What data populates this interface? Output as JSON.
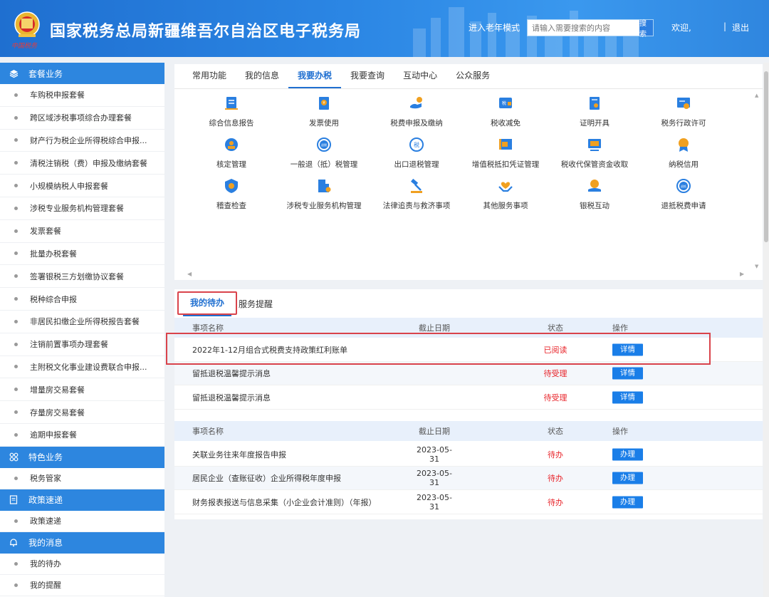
{
  "header": {
    "title": "国家税务总局新疆维吾尔自治区电子税务局",
    "logo_text": "中国税务",
    "elder_mode": "进入老年模式",
    "search_placeholder": "请输入需要搜索的内容",
    "search_button": "搜索",
    "welcome": "欢迎,",
    "separator": "|",
    "logout": "退出",
    "brand_color": "#2b86e4"
  },
  "sidebar": {
    "sections": [
      {
        "label": "套餐业务",
        "icon": "cube-icon",
        "items": [
          "车购税申报套餐",
          "跨区域涉税事项综合办理套餐",
          "财产行为税企业所得税综合申报...",
          "清税注销税（费）申报及缴纳套餐",
          "小规模纳税人申报套餐",
          "涉税专业服务机构管理套餐",
          "发票套餐",
          "批量办税套餐",
          "签署银税三方划缴协议套餐",
          "税种综合申报",
          "非居民扣缴企业所得税报告套餐",
          "注销前置事项办理套餐",
          "主附税文化事业建设费联合申报...",
          "增量房交易套餐",
          "存量房交易套餐",
          "逾期申报套餐"
        ]
      },
      {
        "label": "特色业务",
        "icon": "grid-icon",
        "items": [
          "税务管家"
        ]
      },
      {
        "label": "政策速递",
        "icon": "document-icon",
        "items": [
          "政策速递"
        ]
      },
      {
        "label": "我的消息",
        "icon": "bell-icon",
        "items": [
          "我的待办",
          "我的提醒"
        ]
      }
    ]
  },
  "function_panel": {
    "tabs": [
      "常用功能",
      "我的信息",
      "我要办税",
      "我要查询",
      "互动中心",
      "公众服务"
    ],
    "active_tab": "我要办税",
    "items": [
      {
        "label": "综合信息报告",
        "icon": "report-icon"
      },
      {
        "label": "发票使用",
        "icon": "invoice-icon"
      },
      {
        "label": "税费申报及缴纳",
        "icon": "declare-pay-icon"
      },
      {
        "label": "税收减免",
        "icon": "tax-reduction-icon"
      },
      {
        "label": "证明开具",
        "icon": "certificate-icon"
      },
      {
        "label": "税务行政许可",
        "icon": "permit-icon"
      },
      {
        "label": "核定管理",
        "icon": "assessment-icon"
      },
      {
        "label": "一般退（抵）税管理",
        "icon": "refund-icon"
      },
      {
        "label": "出口退税管理",
        "icon": "export-refund-icon"
      },
      {
        "label": "增值税抵扣凭证管理",
        "icon": "vat-voucher-icon"
      },
      {
        "label": "税收代保管资金收取",
        "icon": "custody-fund-icon"
      },
      {
        "label": "纳税信用",
        "icon": "credit-icon"
      },
      {
        "label": "稽查检查",
        "icon": "inspection-icon"
      },
      {
        "label": "涉税专业服务机构管理",
        "icon": "agency-icon"
      },
      {
        "label": "法律追责与救济事项",
        "icon": "gavel-icon"
      },
      {
        "label": "其他服务事项",
        "icon": "heart-hands-icon"
      },
      {
        "label": "银税互动",
        "icon": "bank-tax-icon"
      },
      {
        "label": "退抵税费申请",
        "icon": "refund-apply-icon"
      }
    ]
  },
  "todo_panel": {
    "tabs": [
      "我的待办",
      "服务提醒"
    ],
    "active_tab": "我的待办",
    "columns": [
      "事项名称",
      "截止日期",
      "状态",
      "操作"
    ],
    "group1": [
      {
        "name": "2022年1-12月组合式税费支持政策红利账单",
        "date": "",
        "status": "已阅读",
        "action": "详情"
      },
      {
        "name": "留抵退税温馨提示消息",
        "date": "",
        "status": "待受理",
        "action": "详情"
      },
      {
        "name": "留抵退税温馨提示消息",
        "date": "",
        "status": "待受理",
        "action": "详情"
      }
    ],
    "group2": [
      {
        "name": "关联业务往来年度报告申报",
        "date": "2023-05-31",
        "status": "待办",
        "action": "办理"
      },
      {
        "name": "居民企业（查账征收）企业所得税年度申报",
        "date": "2023-05-31",
        "status": "待办",
        "action": "办理"
      },
      {
        "name": "财务报表报送与信息采集（小企业会计准则）（年报）",
        "date": "2023-05-31",
        "status": "待办",
        "action": "办理"
      }
    ]
  }
}
